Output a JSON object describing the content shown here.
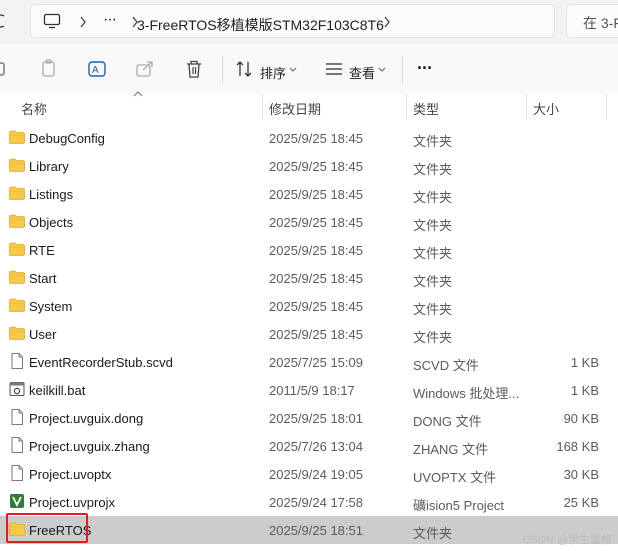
{
  "address_bar": {
    "path_title": "3-FreeRTOS移植模版STM32F103C8T6",
    "overflow": "···"
  },
  "search": {
    "placeholder": "在 3-F"
  },
  "toolbar": {
    "sort_label": "排序",
    "view_label": "查看",
    "more_label": "···"
  },
  "columns": {
    "name": "名称",
    "modified": "修改日期",
    "type": "类型",
    "size": "大小"
  },
  "files": [
    {
      "name": "DebugConfig",
      "date": "2025/9/25 18:45",
      "type": "文件夹",
      "size": "",
      "icon": "folder-icon"
    },
    {
      "name": "Library",
      "date": "2025/9/25 18:45",
      "type": "文件夹",
      "size": "",
      "icon": "folder-icon"
    },
    {
      "name": "Listings",
      "date": "2025/9/25 18:45",
      "type": "文件夹",
      "size": "",
      "icon": "folder-icon"
    },
    {
      "name": "Objects",
      "date": "2025/9/25 18:45",
      "type": "文件夹",
      "size": "",
      "icon": "folder-icon"
    },
    {
      "name": "RTE",
      "date": "2025/9/25 18:45",
      "type": "文件夹",
      "size": "",
      "icon": "folder-icon"
    },
    {
      "name": "Start",
      "date": "2025/9/25 18:45",
      "type": "文件夹",
      "size": "",
      "icon": "folder-icon"
    },
    {
      "name": "System",
      "date": "2025/9/25 18:45",
      "type": "文件夹",
      "size": "",
      "icon": "folder-icon"
    },
    {
      "name": "User",
      "date": "2025/9/25 18:45",
      "type": "文件夹",
      "size": "",
      "icon": "folder-icon"
    },
    {
      "name": "EventRecorderStub.scvd",
      "date": "2025/7/25 15:09",
      "type": "SCVD 文件",
      "size": "1 KB",
      "icon": "file-icon"
    },
    {
      "name": "keilkill.bat",
      "date": "2011/5/9 18:17",
      "type": "Windows 批处理...",
      "size": "1 KB",
      "icon": "batch-file-icon"
    },
    {
      "name": "Project.uvguix.dong",
      "date": "2025/9/25 18:01",
      "type": "DONG 文件",
      "size": "90 KB",
      "icon": "file-icon"
    },
    {
      "name": "Project.uvguix.zhang",
      "date": "2025/7/26 13:04",
      "type": "ZHANG 文件",
      "size": "168 KB",
      "icon": "file-icon"
    },
    {
      "name": "Project.uvoptx",
      "date": "2025/9/24 19:05",
      "type": "UVOPTX 文件",
      "size": "30 KB",
      "icon": "file-icon"
    },
    {
      "name": "Project.uvprojx",
      "date": "2025/9/24 17:58",
      "type": "礦ision5 Project",
      "size": "25 KB",
      "icon": "keil-project-icon"
    },
    {
      "name": "FreeRTOS",
      "date": "2025/9/25 18:51",
      "type": "文件夹",
      "size": "",
      "icon": "folder-icon",
      "selected": true
    }
  ],
  "watermark": "CSDN @学生董格",
  "colors": {
    "folder": "#f7c948",
    "selection": "#cccccc",
    "highlight_border": "#e01e1e",
    "keil_green": "#2e7d32"
  }
}
